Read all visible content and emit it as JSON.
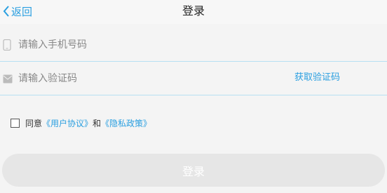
{
  "header": {
    "back_label": "返回",
    "title": "登录"
  },
  "form": {
    "phone_placeholder": "请输入手机号码",
    "code_placeholder": "请输入验证码",
    "get_code_label": "获取验证码"
  },
  "agreement": {
    "prefix": "同意",
    "user_agreement": "《用户协议》",
    "and": "和",
    "privacy_policy": "《隐私政策》",
    "checked": false
  },
  "login_button_label": "登录",
  "colors": {
    "accent": "#2a9fe0",
    "divider": "#b7dff2",
    "button_disabled": "#e6e6e6"
  },
  "icons": [
    "back-chevron-icon",
    "phone-icon",
    "message-icon"
  ]
}
